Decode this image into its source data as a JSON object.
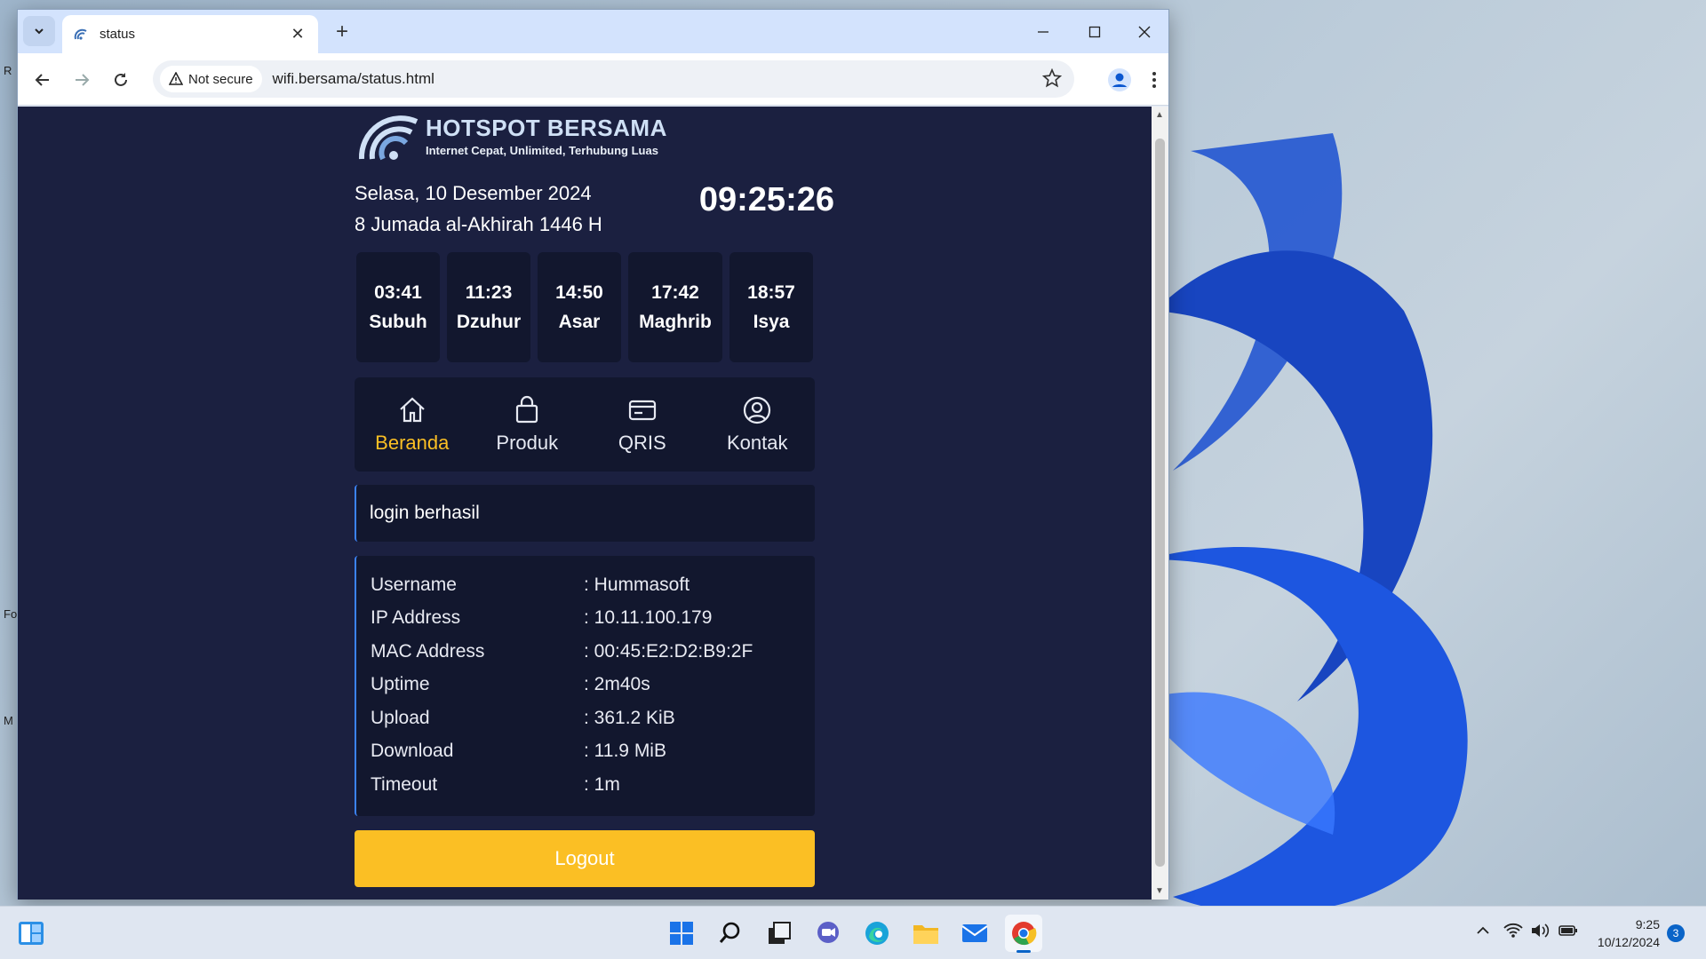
{
  "browser": {
    "tab_title": "status",
    "new_tab": "+",
    "security_chip": "Not secure",
    "url": "wifi.bersama/status.html"
  },
  "brand": {
    "name": "HOTSPOT BERSAMA",
    "tagline": "Internet Cepat, Unlimited, Terhubung Luas"
  },
  "date": {
    "gregorian": "Selasa, 10 Desember 2024",
    "hijri": "8 Jumada al-Akhirah 1446 H",
    "clock": "09:25:26"
  },
  "prayers": [
    {
      "time": "03:41",
      "name": "Subuh"
    },
    {
      "time": "11:23",
      "name": "Dzuhur"
    },
    {
      "time": "14:50",
      "name": "Asar"
    },
    {
      "time": "17:42",
      "name": "Maghrib"
    },
    {
      "time": "18:57",
      "name": "Isya"
    }
  ],
  "nav": [
    {
      "label": "Beranda",
      "icon": "home-icon",
      "active": true
    },
    {
      "label": "Produk",
      "icon": "shopping-bag-icon"
    },
    {
      "label": "QRIS",
      "icon": "card-icon"
    },
    {
      "label": "Kontak",
      "icon": "user-circle-icon"
    }
  ],
  "status_message": "login berhasil",
  "info": [
    {
      "label": "Username",
      "value": ": Hummasoft"
    },
    {
      "label": "IP Address",
      "value": ": 10.11.100.179"
    },
    {
      "label": "MAC Address",
      "value": ": 00:45:E2:D2:B9:2F"
    },
    {
      "label": "Uptime",
      "value": ": 2m40s"
    },
    {
      "label": "Upload",
      "value": ": 361.2 KiB"
    },
    {
      "label": "Download",
      "value": ": 11.9 MiB"
    },
    {
      "label": "Timeout",
      "value": ": 1m"
    }
  ],
  "logout_label": "Logout",
  "taskbar": {
    "time": "9:25",
    "date": "10/12/2024",
    "notification_count": "3"
  },
  "colors": {
    "page_bg": "#1b2040",
    "card_bg": "#12172e",
    "accent": "#fbbf24",
    "border_accent": "#3b82f6"
  }
}
